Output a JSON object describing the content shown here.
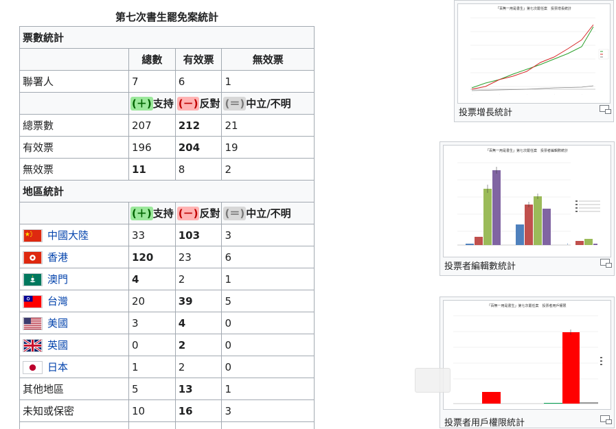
{
  "title": "第七次書生罷免案統計",
  "vote_stats": {
    "section_label": "票數統計",
    "col_headers": [
      "總數",
      "有效票",
      "無效票"
    ],
    "signatories": {
      "label": "聯署人",
      "values": [
        "7",
        "6",
        "1"
      ]
    },
    "position_headers": {
      "support": "支持",
      "oppose": "反對",
      "neutral": "中立/不明"
    },
    "markers": {
      "plus": "(＋)",
      "minus": "(－)",
      "equal": "(＝)"
    },
    "rows": [
      {
        "label": "總票數",
        "values": [
          "207",
          "212",
          "21"
        ]
      },
      {
        "label": "有效票",
        "values": [
          "196",
          "204",
          "19"
        ]
      },
      {
        "label": "無效票",
        "values": [
          "11",
          "8",
          "2"
        ]
      }
    ]
  },
  "region_stats": {
    "section_label": "地區統計",
    "rows": [
      {
        "label": "中國大陸",
        "flag": "cn",
        "link": true,
        "values": [
          "33",
          "103",
          "3"
        ]
      },
      {
        "label": "香港",
        "flag": "hk",
        "link": true,
        "values": [
          "120",
          "23",
          "6"
        ]
      },
      {
        "label": "澳門",
        "flag": "mo",
        "link": true,
        "values": [
          "4",
          "2",
          "1"
        ]
      },
      {
        "label": "台灣",
        "flag": "tw",
        "link": true,
        "values": [
          "20",
          "39",
          "5"
        ]
      },
      {
        "label": "美國",
        "flag": "us",
        "link": true,
        "values": [
          "3",
          "4",
          "0"
        ]
      },
      {
        "label": "英國",
        "flag": "uk",
        "link": true,
        "values": [
          "0",
          "2",
          "0"
        ]
      },
      {
        "label": "日本",
        "flag": "jp",
        "link": true,
        "values": [
          "1",
          "2",
          "0"
        ]
      },
      {
        "label": "其他地區",
        "link": false,
        "values": [
          "5",
          "13",
          "1"
        ]
      },
      {
        "label": "未知或保密",
        "link": false,
        "values": [
          "10",
          "16",
          "3"
        ]
      }
    ]
  },
  "thumbnails": [
    {
      "caption": "投票增長統計",
      "image_title": "「百無一用是書生」第七次罷任案　投票增長統計"
    },
    {
      "caption": "投票者編輯數統計",
      "image_title": "「百無一用是書生」第七次罷任案　投票者編輯數統計"
    },
    {
      "caption": "投票者用戶權限統計",
      "image_title": "「百無一用是書生」第七次罷任案　投票者用戶權限"
    }
  ],
  "colors": {
    "support": "#9be89b",
    "oppose": "#ffb3b3",
    "neutral": "#d8d8d8",
    "link": "#0645ad"
  }
}
